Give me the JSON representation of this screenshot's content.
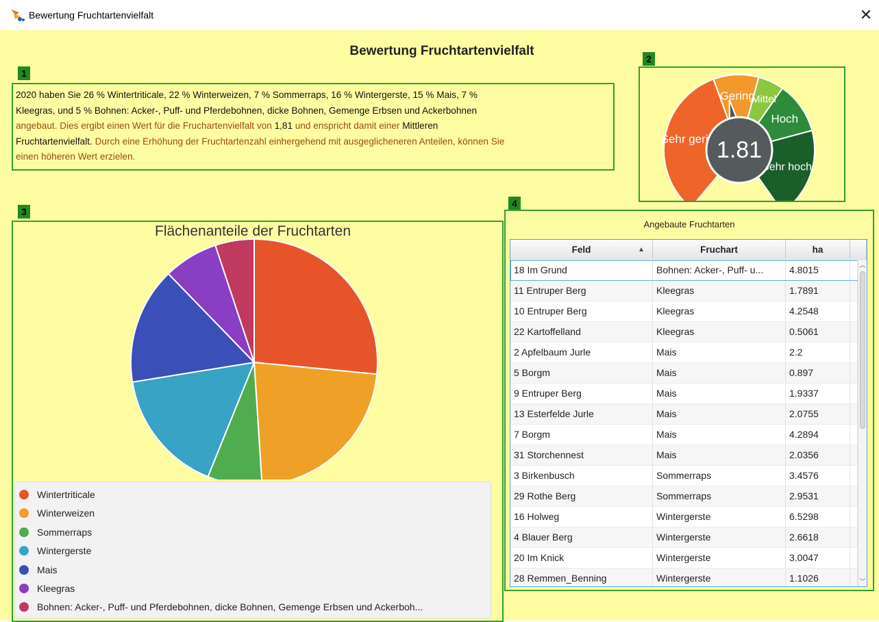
{
  "window": {
    "title": "Bewertung Fruchtartenvielfalt",
    "close_label": "✕",
    "app_icon": "tractor-icon"
  },
  "heading": "Bewertung Fruchtartenvielfalt",
  "badges": {
    "b1": "1",
    "b2": "2",
    "b3": "3",
    "b4": "4"
  },
  "summary": {
    "line1": "2020 haben Sie 26 % Wintertriticale, 22 % Winterweizen, 7 % Sommerraps, 16 % Wintergerste, 15 % Mais, 7 %",
    "line2": "Kleegras,  und 5 % Bohnen: Acker-, Puff- und Pferdebohnen, dicke Bohnen, Gemenge Erbsen und Ackerbohnen",
    "line3a": "angebaut. Dies ergibt einen Wert für die Fruchartenvielfalt von ",
    "line3b": "1,81",
    "line3c": " und enspricht damit einer ",
    "line3d": "Mittleren",
    "line4a": "Fruchtartenvielfalt.",
    "line4b": " Durch eine Erhöhung der Fruchtartenzahl einhergehend mit ausgeglicheneren Anteilen, können Sie",
    "line5": "einen höheren Wert erzielen."
  },
  "gauge": {
    "value": 1.81,
    "value_label": "1.81",
    "segments": [
      {
        "label": "Sehr gering",
        "color": "#ef6428"
      },
      {
        "label": "Gering",
        "color": "#f3982c"
      },
      {
        "label": "Mittel",
        "color": "#8dc63f"
      },
      {
        "label": "Hoch",
        "color": "#2e8b3a"
      },
      {
        "label": "Sehr hoch",
        "color": "#1a5e2a"
      }
    ]
  },
  "chart_data": {
    "type": "pie",
    "title": "Flächenanteile der Fruchtarten",
    "categories": [
      "Wintertriticale",
      "Winterweizen",
      "Sommerraps",
      "Wintergerste",
      "Mais",
      "Kleegras",
      "Bohnen: Acker-, Puff- und Pferdebohnen, dicke Bohnen, Gemenge Erbsen und Ackerboh..."
    ],
    "values": [
      26,
      22,
      7,
      16,
      15,
      7,
      5
    ],
    "colors": [
      "#e8542a",
      "#eea126",
      "#4fad4f",
      "#38a3c4",
      "#3a4fb8",
      "#8a3ec4",
      "#c0395f"
    ],
    "legend": "bottom"
  },
  "table": {
    "caption": "Angebaute Fruchtarten",
    "columns": [
      "Feld",
      "Fruchart",
      "ha"
    ],
    "rows": [
      [
        "18 Im Grund",
        "Bohnen: Acker-, Puff- u...",
        "4.8015"
      ],
      [
        "11 Entruper Berg",
        "Kleegras",
        "1.7891"
      ],
      [
        "10 Entruper Berg",
        "Kleegras",
        "4.2548"
      ],
      [
        "22 Kartoffelland",
        "Kleegras",
        "0.5061"
      ],
      [
        "2 Apfelbaum Jurle",
        "Mais",
        "2.2"
      ],
      [
        "5 Borgm",
        "Mais",
        "0.897"
      ],
      [
        "9 Entruper Berg",
        "Mais",
        "1.9337"
      ],
      [
        "13 Esterfelde Jurle",
        "Mais",
        "2.0755"
      ],
      [
        "7 Borgm",
        "Mais",
        "4.2894"
      ],
      [
        "31 Storchennest",
        "Mais",
        "2.0356"
      ],
      [
        "3 Birkenbusch",
        "Sommerraps",
        "3.4576"
      ],
      [
        "29 Rothe Berg",
        "Sommerraps",
        "2.9531"
      ],
      [
        "16 Holweg",
        "Wintergerste",
        "6.5298"
      ],
      [
        "4 Blauer Berg",
        "Wintergerste",
        "2.6618"
      ],
      [
        "20 Im Knick",
        "Wintergerste",
        "3.0047"
      ],
      [
        "28 Remmen_Benning",
        "Wintergerste",
        "1.1026"
      ]
    ]
  }
}
